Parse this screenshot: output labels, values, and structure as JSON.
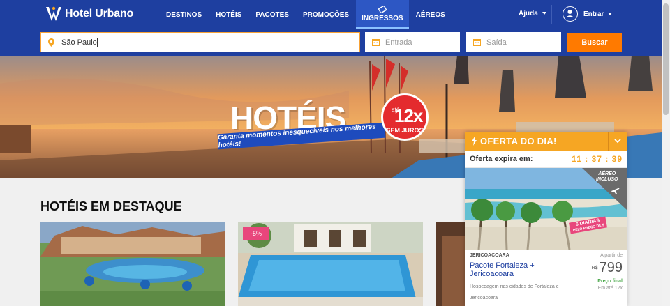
{
  "header": {
    "brand": "Hotel Urbano",
    "nav": [
      "DESTINOS",
      "HOTÉIS",
      "PACOTES",
      "PROMOÇÕES",
      "INGRESSOS",
      "AÉREOS"
    ],
    "help": "Ajuda",
    "login": "Entrar",
    "colors": {
      "nav_bg": "#1e3fa0",
      "active_tab": "#2d57c4"
    }
  },
  "search": {
    "destination": "São Paulo",
    "checkin_placeholder": "Entrada",
    "checkout_placeholder": "Saída",
    "button": "Buscar",
    "colors": {
      "button": "#ff7a00"
    }
  },
  "hero": {
    "title": "HOTÉIS",
    "subtitle": "Garanta momentos inesquecíveis nos melhores hotéis!",
    "badge_until": "até",
    "badge_value": "12x",
    "badge_sub": "SEM JUROS"
  },
  "section": {
    "title": "HOTÉIS EM DESTAQUE",
    "cards": [
      {
        "discount": ""
      },
      {
        "discount": "-5%"
      },
      {
        "discount": ""
      }
    ]
  },
  "offer": {
    "title": "OFERTA DO DIA!",
    "expires_label": "Oferta expira em:",
    "countdown": "11 : 37 : 39",
    "flight_tag": [
      "AÉREO",
      "INCLUSO"
    ],
    "diarias": [
      "6 DIÁRIAS",
      "PELO PREÇO DE 5"
    ],
    "region": "JERICOACOARA",
    "package_name": "Pacote Fortaleza + Jericoacoara",
    "description": "Hospedagem nas cidades de Fortaleza e Jericoacoara",
    "from_label": "A partir de",
    "currency": "R$",
    "price": "799",
    "final_label": "Preço final",
    "installments": "Em até 12x",
    "colors": {
      "header": "#f6a623"
    }
  }
}
